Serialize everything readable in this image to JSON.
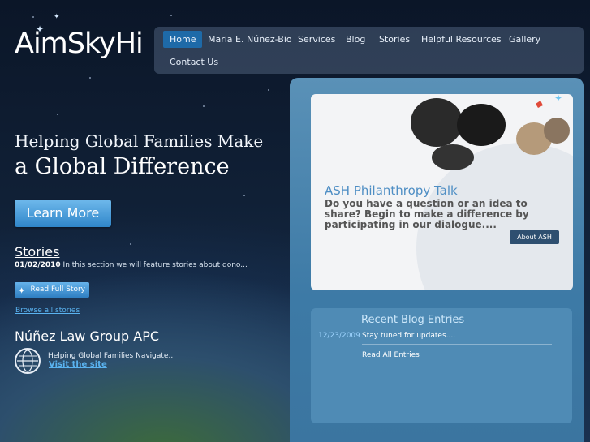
{
  "logo": {
    "text": "AimSkyHi"
  },
  "nav": {
    "items": [
      {
        "label": "Home",
        "active": true
      },
      {
        "label": "Maria E. Núñez-Bio"
      },
      {
        "label": "Services"
      },
      {
        "label": "Blog"
      },
      {
        "label": "Stories"
      },
      {
        "label": "Helpful Resources"
      },
      {
        "label": "Gallery"
      },
      {
        "label": "Contact Us"
      }
    ]
  },
  "hero": {
    "line1": "Helping Global Families Make",
    "line2": "a Global Difference",
    "button": "Learn More"
  },
  "stories": {
    "heading": "Stories",
    "date": "01/02/2010",
    "teaser": "In this section we will feature stories about dono...",
    "read_full": "Read Full Story",
    "browse_all": "Browse all stories"
  },
  "nunez": {
    "heading": "Núñez Law Group APC",
    "desc": "Helping Global Families Navigate...",
    "visit": "Visit the site"
  },
  "ash": {
    "title": "ASH Philanthropy Talk",
    "text": "Do you have a question or an idea to share? Begin to make a difference by participating in our dialogue....",
    "button": "About ASH"
  },
  "blog": {
    "title": "Recent Blog Entries",
    "entries": [
      {
        "date": "12/23/2009",
        "text": "Stay tuned for updates...."
      }
    ],
    "read_all": "Read All Entries"
  },
  "colors": {
    "nav_active": "#1e6aa8",
    "link": "#5ab3f0",
    "panel": "#4f8bb5"
  }
}
